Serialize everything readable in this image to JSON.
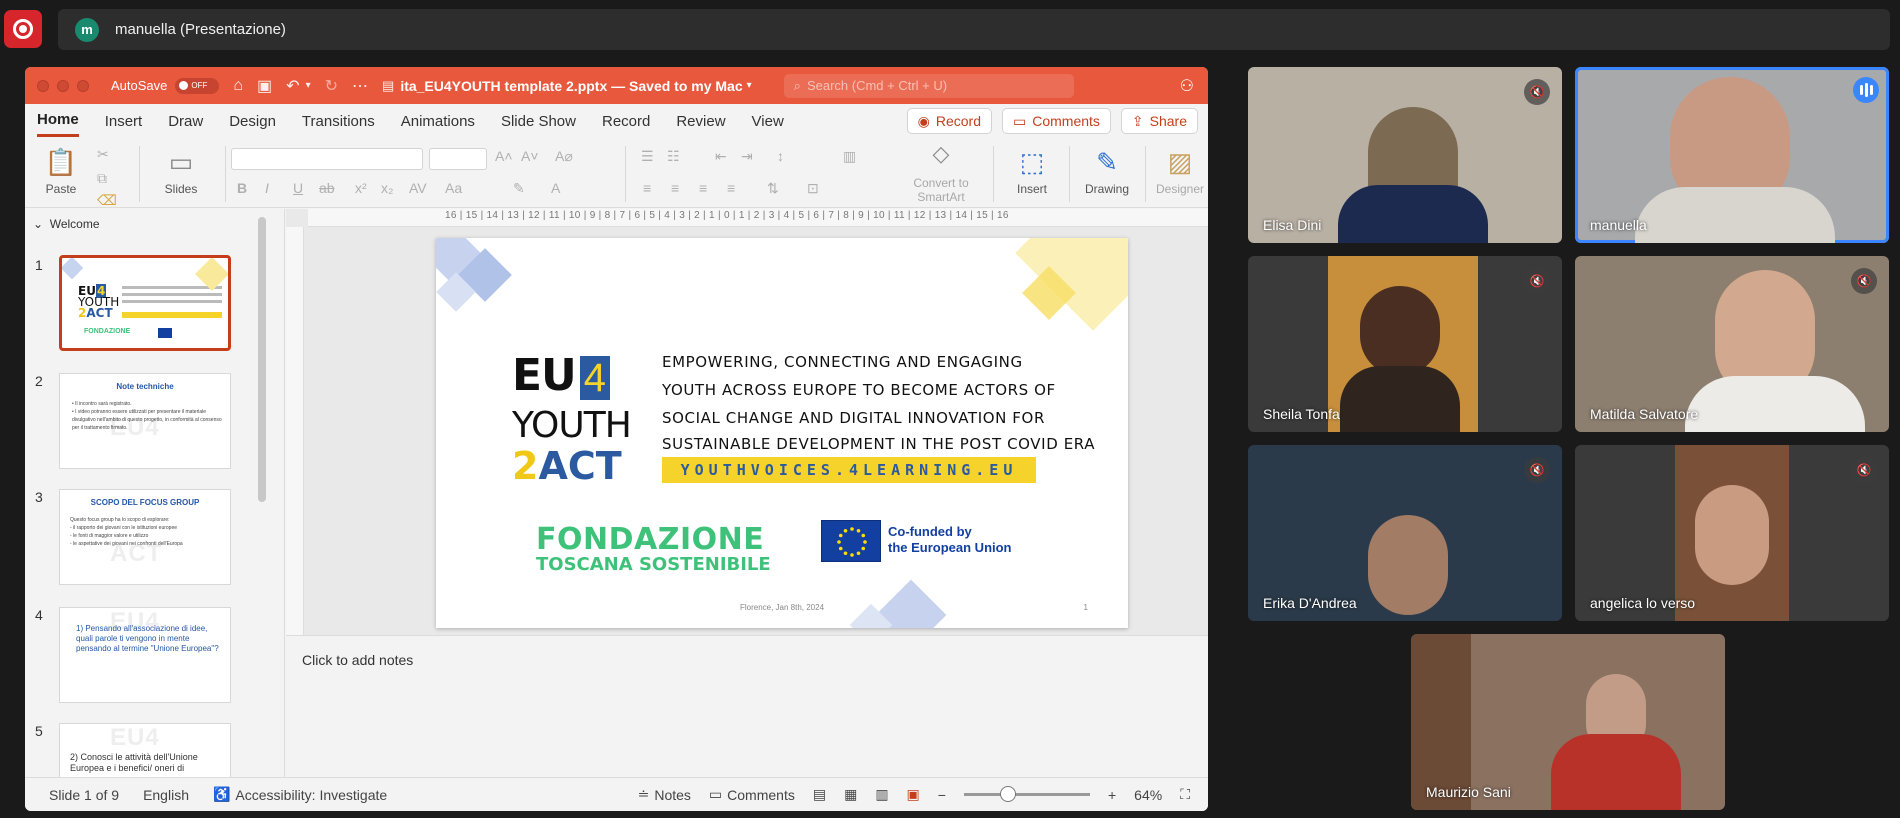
{
  "meeting": {
    "presenter_initial": "m",
    "presenter_label": "manuella (Presentazione)"
  },
  "ppt": {
    "autosave_label": "AutoSave",
    "autosave_state": "OFF",
    "doc_title": "ita_EU4YOUTH template 2.pptx — Saved to my Mac",
    "search_placeholder": "Search (Cmd + Ctrl + U)",
    "tabs": [
      "Home",
      "Insert",
      "Draw",
      "Design",
      "Transitions",
      "Animations",
      "Slide Show",
      "Record",
      "Review",
      "View"
    ],
    "record_label": "Record",
    "comments_label": "Comments",
    "share_label": "Share",
    "ribbon": {
      "paste": "Paste",
      "slides": "Slides",
      "convert_smartart_1": "Convert to",
      "convert_smartart_2": "SmartArt",
      "insert": "Insert",
      "drawing": "Drawing",
      "designer": "Designer"
    },
    "section": "Welcome",
    "thumbs": [
      {
        "num": "1"
      },
      {
        "num": "2",
        "title": "Note techniche",
        "body": [
          "• Il incontro sarà registrato.",
          "• I video potranno essere utilizzati per presentare il materiale divulgativo nell'ambito di questo progetto, in conformità al consenso per il trattamento firmato."
        ]
      },
      {
        "num": "3",
        "title": "SCOPO DEL FOCUS GROUP",
        "body": [
          "Questo focus group ha lo scopo di esplorare:",
          "- il rapporto dei giovani con le istituzioni europee",
          "- le fonti di maggior valore e utilizzo",
          "- le aspettative dei giovani nei confronti dell'Europa"
        ]
      },
      {
        "num": "4",
        "q": "1)   Pensando all'associazione di idee, quali parole ti vengono in mente pensando al termine \"Unione Europea\"?"
      },
      {
        "num": "5",
        "q2": "2) Conosci le attività dell'Unione Europea e i benefici/ oneri di"
      }
    ],
    "ruler_numbers": "16 | 15 | 14 | 13 | 12 | 11 | 10 | 9 | 8 | 7 | 6 | 5 | 4 | 3 | 2 | 1 | 0 | 1 | 2 | 3 | 4 | 5 | 6 | 7 | 8 | 9 | 10 | 11 | 12 | 13 | 14 | 15 | 16",
    "slide": {
      "logo_eu": "EU",
      "logo_4": "4",
      "logo_youth": "YOUTH",
      "logo_2": "2",
      "logo_act": "ACT",
      "tagline_1": "EMPOWERING, CONNECTING AND ENGAGING",
      "tagline_2": "YOUTH ACROSS EUROPE TO BECOME ACTORS OF",
      "tagline_3": "SOCIAL CHANGE AND DIGITAL INNOVATION FOR",
      "tagline_4": "SUSTAINABLE DEVELOPMENT IN THE POST COVID ERA",
      "url": "YOUTHVOICES.4LEARNING.EU",
      "fondazione_1": "FONDAZIONE",
      "fondazione_2": "TOSCANA SOSTENIBILE",
      "cofunded_1": "Co-funded by",
      "cofunded_2": "the European Union",
      "footer": "Florence, Jan 8th, 2024",
      "page": "1"
    },
    "notes_placeholder": "Click to add notes",
    "status": {
      "slide": "Slide 1 of 9",
      "language": "English",
      "accessibility": "Accessibility: Investigate",
      "notes": "Notes",
      "comments": "Comments",
      "zoom": "64%",
      "zoom_fraction": 0.35
    }
  },
  "participants": [
    {
      "name": "Elisa Dini",
      "muted": true,
      "speaking": false
    },
    {
      "name": "manuella",
      "muted": false,
      "speaking": true
    },
    {
      "name": "Sheila Tonfa",
      "muted": true,
      "speaking": false
    },
    {
      "name": "Matilda Salvatore",
      "muted": true,
      "speaking": false
    },
    {
      "name": "Erika D'Andrea",
      "muted": true,
      "speaking": false
    },
    {
      "name": "angelica lo verso",
      "muted": true,
      "speaking": false
    },
    {
      "name": "Maurizio Sani",
      "muted": false,
      "speaking": false
    }
  ],
  "colors": {
    "ppt_accent": "#c43e1c",
    "title_bar": "#e8583d",
    "speaking_outline": "#3b86ff",
    "record_button": "#d7262b"
  }
}
